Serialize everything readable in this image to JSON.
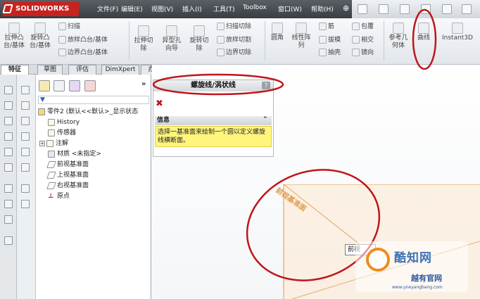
{
  "app": {
    "name": "SOLIDWORKS"
  },
  "menu": [
    "文件(F)",
    "编辑(E)",
    "视图(V)",
    "插入(I)",
    "工具(T)",
    "Toolbox",
    "窗口(W)",
    "帮助(H)"
  ],
  "ribbon": {
    "big": [
      {
        "label": "拉伸凸\n台/基体"
      },
      {
        "label": "旋转凸\n台/基体"
      },
      {
        "label": "拉伸切\n除"
      },
      {
        "label": "异型孔\n向导"
      },
      {
        "label": "旋转切\n除"
      },
      {
        "label": "圆角"
      },
      {
        "label": "线性阵\n列"
      },
      {
        "label": "参考几\n何体"
      },
      {
        "label": "曲线"
      },
      {
        "label": "Instant3D"
      }
    ],
    "col1": [
      "扫描",
      "放样凸台/基体",
      "边界凸台/基体"
    ],
    "col2": [
      "扫描切除",
      "放样切割",
      "边界切除"
    ],
    "col3": [
      "筋",
      "拔模",
      "抽壳"
    ],
    "col4": [
      "包覆",
      "相交",
      "镜向"
    ]
  },
  "tabs": [
    "特征",
    "草图",
    "评估",
    "DimXpert",
    "办公室产品"
  ],
  "tree": {
    "root": "零件2 (默认<<默认>_显示状态",
    "items": [
      "History",
      "传感器",
      "注解",
      "材质 <未指定>",
      "前视基准面",
      "上视基准面",
      "右视基准面",
      "原点"
    ]
  },
  "property_manager": {
    "title": "螺旋线/涡状线",
    "help": "?",
    "info_header": "信息",
    "info_text": "选择一基准面来绘制一个圆以定义螺旋线横断面。"
  },
  "viewport": {
    "plane_label": "前视基准面",
    "tag": "前视"
  },
  "watermark": {
    "line1": "酷知网",
    "line2": "越有官网",
    "url": "www.yneyangbang.com"
  },
  "colors": {
    "titlebar": "#43474d",
    "accent_red": "#c8221f",
    "info_yellow": "#fff57d",
    "plane_orange": "#e09a4a",
    "annotation_red": "#c0151a"
  }
}
